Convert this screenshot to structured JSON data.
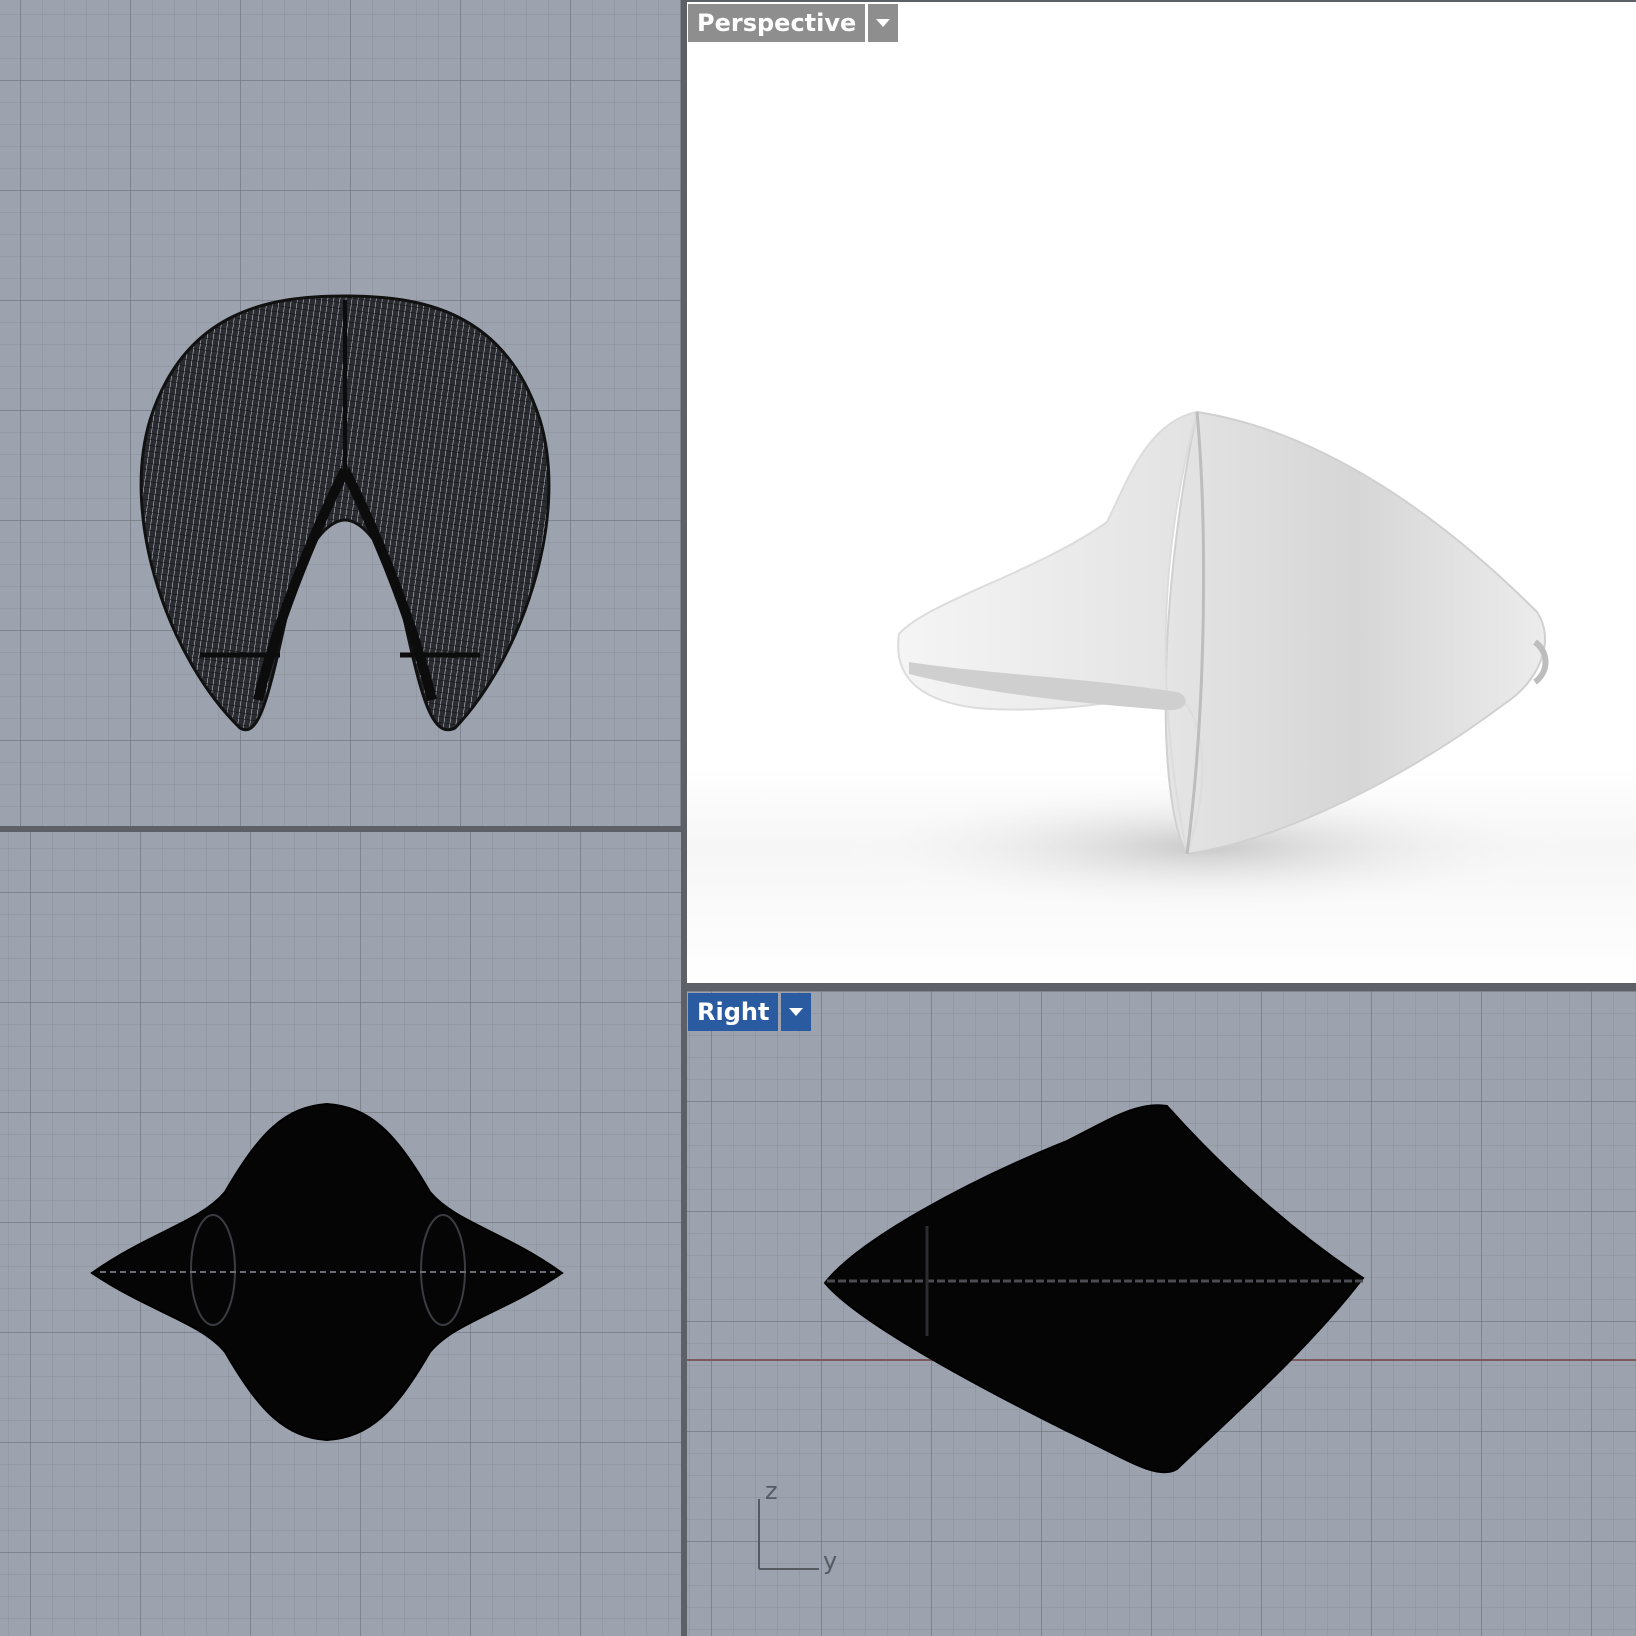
{
  "viewports": {
    "perspective": {
      "label": "Perspective"
    },
    "right": {
      "label": "Right",
      "axis_z": "z",
      "axis_y": "y"
    }
  },
  "colors": {
    "viewport_bg": "#9da3ae",
    "active_tab": "#2a5ba0",
    "inactive_tab": "#8e8e8e",
    "divider": "#5e6068",
    "mesh": "#111111"
  },
  "icons": {
    "dropdown": "chevron-down-icon"
  }
}
